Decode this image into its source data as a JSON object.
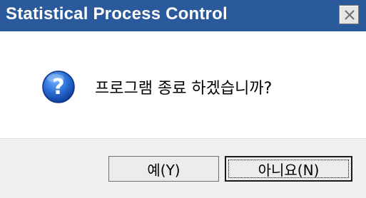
{
  "dialog": {
    "title": "Statistical Process Control",
    "message": "프로그램 종료 하겠습니까?",
    "icon": "question-icon",
    "close_icon": "close-icon",
    "colors": {
      "titlebar": "#2b5a9c",
      "title_text": "#ffffff",
      "button_bar": "#f0f0f0"
    }
  },
  "buttons": {
    "yes_label": "예(Y)",
    "no_label": "아니요(N)"
  }
}
